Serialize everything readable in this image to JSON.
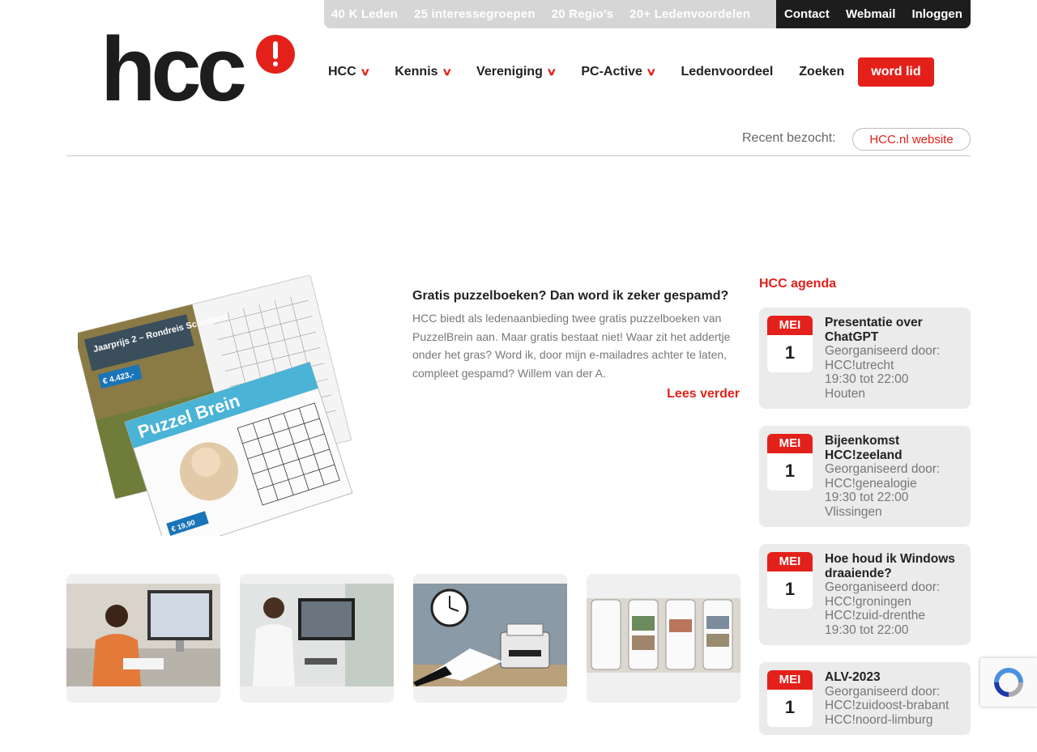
{
  "topbar": {
    "stats": [
      "40 K Leden",
      "25 interessegroepen",
      "20 Regio's",
      "20+ Ledenvoordelen"
    ],
    "links": [
      "Contact",
      "Webmail",
      "Inloggen"
    ]
  },
  "logo": {
    "text": "hcc"
  },
  "nav": {
    "items": [
      {
        "label": "HCC",
        "dropdown": true
      },
      {
        "label": "Kennis",
        "dropdown": true
      },
      {
        "label": "Vereniging",
        "dropdown": true
      },
      {
        "label": "PC-Active",
        "dropdown": true
      },
      {
        "label": "Ledenvoordeel",
        "dropdown": false
      },
      {
        "label": "Zoeken",
        "dropdown": false
      }
    ],
    "cta": "word lid"
  },
  "recent": {
    "label": "Recent bezocht:",
    "link": "HCC.nl website"
  },
  "featured": {
    "title": "Gratis puzzelboeken? Dan word ik zeker gespamd?",
    "text": "HCC biedt als ledenaanbieding twee gratis puzzelboeken van PuzzelBrein aan. Maar gratis bestaat niet! Waar zit het addertje onder het gras? Word ik, door mijn e-mailadres achter te laten, compleet gespamd? Willem van der A.",
    "more": "Lees verder",
    "image_text": [
      "Jaarprijs 2 – Rondreis Schotland",
      "€ 4.423,-",
      "Puzzel Brein",
      "€ 19,90"
    ]
  },
  "agenda": {
    "title": "HCC agenda",
    "events": [
      {
        "month": "MEI",
        "day": "1",
        "title": "Presentatie over ChatGPT",
        "lines": [
          "Georganiseerd door:",
          "HCC!utrecht",
          "19:30 tot 22:00",
          "Houten"
        ]
      },
      {
        "month": "MEI",
        "day": "1",
        "title": "Bijeenkomst HCC!zeeland",
        "lines": [
          "Georganiseerd door:",
          "HCC!genealogie",
          "19:30 tot 22:00",
          "Vlissingen"
        ]
      },
      {
        "month": "MEI",
        "day": "1",
        "title": "Hoe houd ik Windows draaiende?",
        "lines": [
          "Georganiseerd door:",
          "HCC!groningen",
          "HCC!zuid-drenthe",
          "19:30 tot 22:00"
        ]
      },
      {
        "month": "MEI",
        "day": "1",
        "title": "ALV-2023",
        "lines": [
          "Georganiseerd door:",
          "HCC!zuidoost-brabant",
          "HCC!noord-limburg"
        ]
      }
    ]
  },
  "colors": {
    "accent": "#e3211a",
    "dark": "#1d1d1d",
    "topbar_grey": "#d6d6d6"
  }
}
